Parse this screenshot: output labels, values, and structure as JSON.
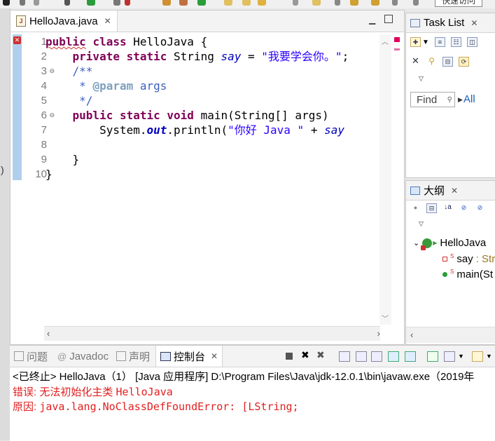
{
  "window": {
    "quick_access": "快速访问"
  },
  "gutter": {
    "paren": ")"
  },
  "editor": {
    "tab_label": "HelloJava.java",
    "line_numbers": [
      "1",
      "2",
      "3",
      "4",
      "5",
      "6",
      "7",
      "8",
      "9",
      "10"
    ],
    "code": {
      "l1_kw1": "public",
      "l1_kw2": "class",
      "l1_name": " HelloJava {",
      "l2_kw1": "private",
      "l2_kw2": "static",
      "l2_type": " String ",
      "l2_field": "say",
      "l2_eq": " = ",
      "l2_str": "\"我要学会你。\"",
      "l2_end": ";",
      "l3": "/**",
      "l4_star": " * ",
      "l4_tag": "@param",
      "l4_rest": " args",
      "l5": " */",
      "l6_kw1": "public",
      "l6_kw2": "static",
      "l6_kw3": "void",
      "l6_rest": " main(String[] args)",
      "l7_pre": "System.",
      "l7_out": "out",
      "l7_mid": ".println(",
      "l7_str": "\"你好 Java \"",
      "l7_plus": " + ",
      "l7_say": "say",
      "l9": "}",
      "l10": "}"
    }
  },
  "task_list": {
    "title": "Task List",
    "find_placeholder": "Find",
    "all_label": "All"
  },
  "outline": {
    "title": "大纲",
    "class_name": "HelloJava",
    "field_name": "say",
    "field_type": " : Str",
    "method_name": "main(St"
  },
  "console": {
    "tabs": {
      "problems": "问题",
      "javadoc": "Javadoc",
      "declaration": "声明",
      "console": "控制台"
    },
    "status_line": "<已终止> HelloJava（1） [Java 应用程序] D:\\Program Files\\Java\\jdk-12.0.1\\bin\\javaw.exe（2019年",
    "error_label": "错误: ",
    "error_text": "无法初始化主类 ",
    "error_class": "HelloJava",
    "cause_label": "原因: ",
    "cause_text": "java.lang.NoClassDefFoundError: [LString;"
  },
  "colors": {
    "keyword": "#7f0055",
    "string": "#2a00ff",
    "javadoc": "#3f5fbf",
    "error": "#e02020",
    "link": "#1a5fb4"
  }
}
